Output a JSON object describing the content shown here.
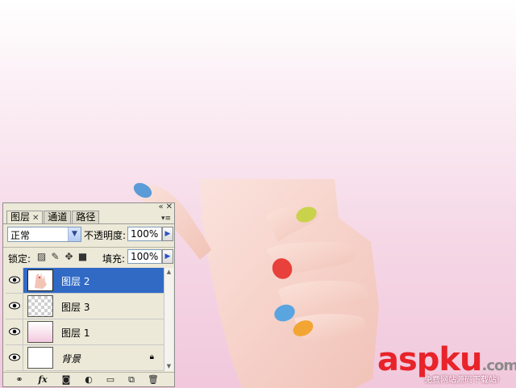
{
  "watermark": {
    "brand": "aspku",
    "tld": ".com",
    "tagline": "免费网站源码下载站!"
  },
  "colors": {
    "selection": "#316ac5",
    "panel_bg": "#ece9d8",
    "watermark_red": "#e8232a",
    "nail_colors": [
      "#5b9bd8",
      "#c8d24a",
      "#e8403a",
      "#5aa5e0",
      "#f2a532"
    ]
  },
  "panel": {
    "tabs": [
      {
        "label": "图层",
        "active": true
      },
      {
        "label": "通道",
        "active": false
      },
      {
        "label": "路径",
        "active": false
      }
    ],
    "blend_mode": "正常",
    "opacity_label": "不透明度:",
    "opacity_value": "100%",
    "lock_label": "锁定:",
    "fill_label": "填充:",
    "fill_value": "100%",
    "layers": [
      {
        "name": "图层 2",
        "selected": true,
        "visible": true,
        "thumb": "hand-thumbnail"
      },
      {
        "name": "图层 3",
        "selected": false,
        "visible": true,
        "thumb": "transparent"
      },
      {
        "name": "图层 1",
        "selected": false,
        "visible": true,
        "thumb": "pink-gradient"
      },
      {
        "name": "背景",
        "selected": false,
        "visible": true,
        "thumb": "white",
        "locked": true
      }
    ],
    "bottom_icons": [
      "link-icon",
      "fx-icon",
      "mask-icon",
      "adjustment-icon",
      "folder-icon",
      "new-layer-icon",
      "trash-icon"
    ]
  }
}
